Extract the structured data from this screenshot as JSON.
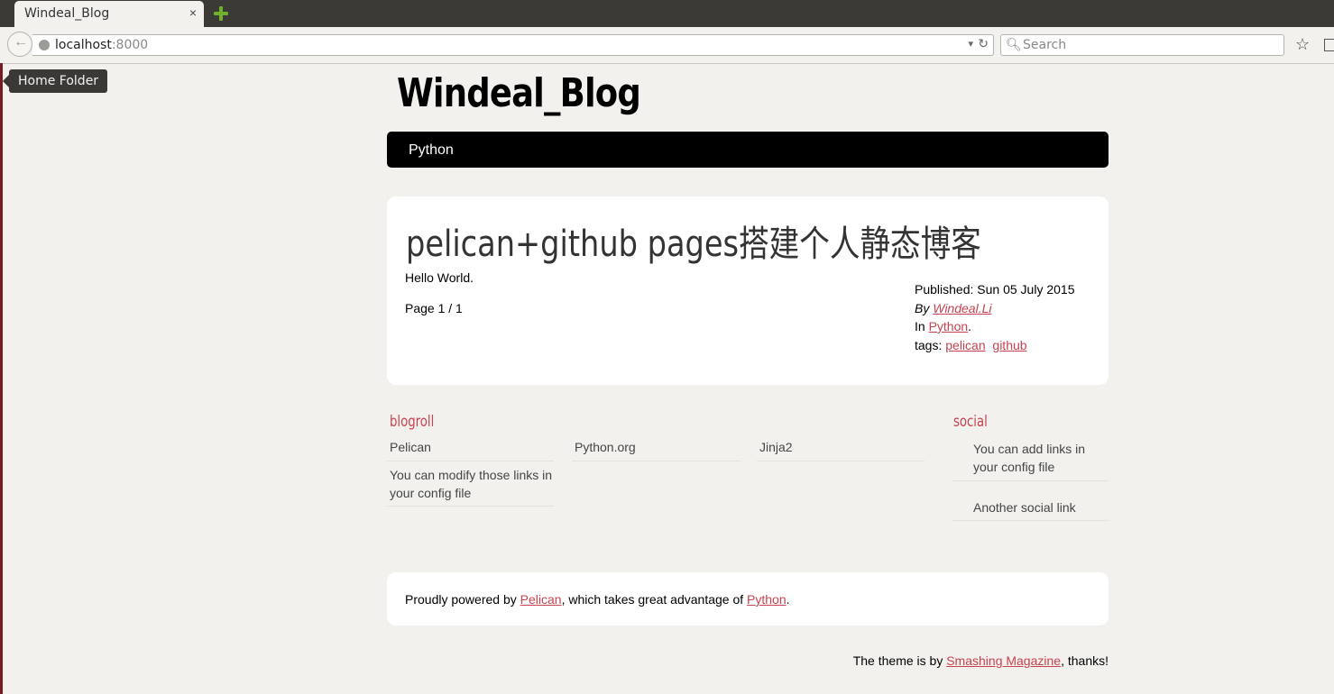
{
  "browser": {
    "tab_title": "Windeal_Blog",
    "tab_close": "×",
    "url_host": "localhost",
    "url_port": ":8000",
    "search_placeholder": "Search",
    "tooltip": "Home Folder"
  },
  "site": {
    "title": "Windeal_Blog",
    "nav": [
      "Python"
    ]
  },
  "article": {
    "title": "pelican+github pages搭建个人静态博客",
    "body": "Hello World.",
    "page_info": "Page 1 / 1",
    "published_label": "Published:",
    "published_date": "Sun 05 July 2015",
    "by_label": "By",
    "author": "Windeal.Li",
    "in_label": "In",
    "category": "Python",
    "tags_label": "tags:",
    "tags": [
      "pelican",
      "github"
    ]
  },
  "blogroll": {
    "title": "blogroll",
    "links": [
      "Pelican",
      "Python.org",
      "Jinja2",
      "You can modify those links in your config file"
    ]
  },
  "social": {
    "title": "social",
    "links": [
      "You can add links in your config file",
      "Another social link"
    ]
  },
  "footer": {
    "prefix": "Proudly powered by",
    "pelican": "Pelican",
    "middle": ", which takes great advantage of",
    "python": "Python",
    "suffix": ".",
    "theme_prefix": "The theme is by",
    "theme_link": "Smashing Magazine",
    "theme_suffix": ", thanks!"
  },
  "colors": {
    "link": "#c74350",
    "nav_bg": "#000000",
    "page_bg": "#f2f1ed"
  }
}
